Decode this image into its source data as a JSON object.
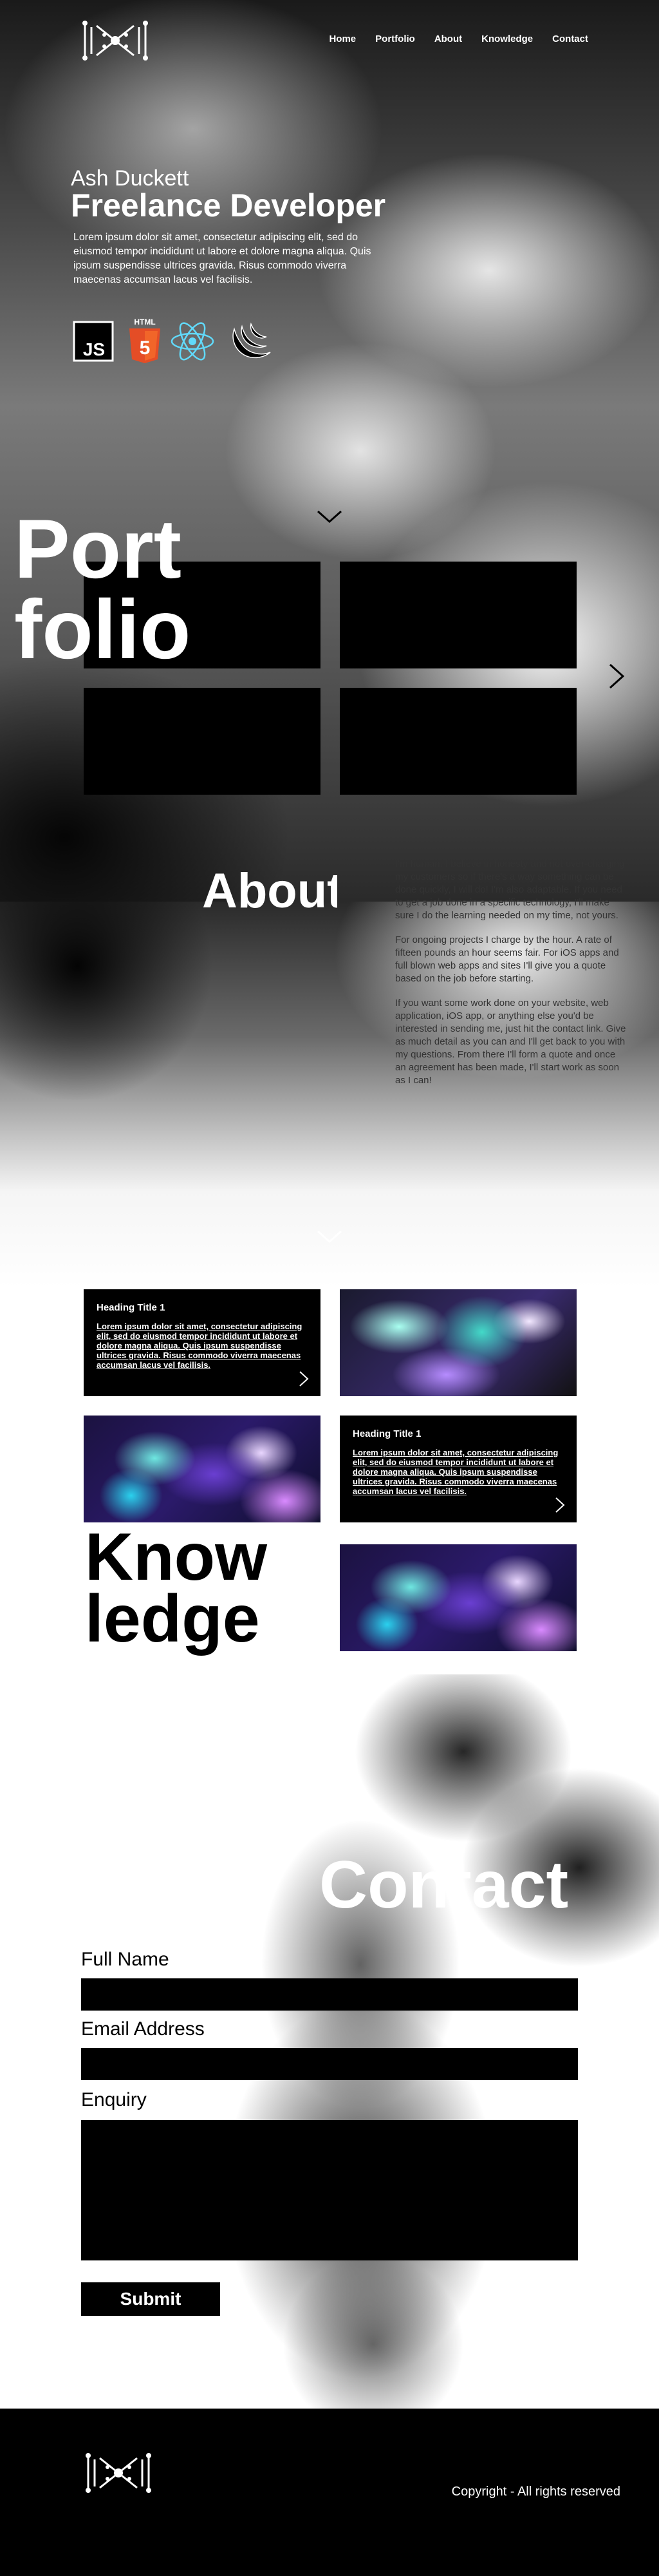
{
  "nav": {
    "logo": "logo-icon",
    "items": [
      "Home",
      "Portfolio",
      "About",
      "Knowledge",
      "Contact"
    ]
  },
  "hero": {
    "name": "Ash Duckett",
    "title": "Freelance Developer",
    "text": "Lorem ipsum dolor sit amet, consectetur adipiscing elit, sed do eiusmod tempor incididunt ut labore et dolore magna aliqua. Quis ipsum suspendisse ultrices gravida. Risus commodo viverra maecenas accumsan lacus vel facilisis.",
    "tech_icons": [
      {
        "name": "js-icon",
        "label": "JS"
      },
      {
        "name": "html5-icon",
        "label": "HTML",
        "number": "5"
      },
      {
        "name": "react-icon"
      },
      {
        "name": "jquery-icon"
      }
    ]
  },
  "portfolio": {
    "heading_line1": "Port",
    "heading_line2": "folio"
  },
  "about": {
    "heading": "About",
    "paragraphs": [
      "I'm human. I believe in honesty and not over-charging my customers so if there's a way something can be done quickly, I will do! I'm also adaptable. If you need to get a job done in a specific technology, I'll make sure I do the learning needed on my time, not yours.",
      "For ongoing projects I charge by the hour. A rate of fifteen pounds an hour seems fair. For iOS apps and full blown web apps and sites I'll give you a quote based on the job before starting.",
      "If you want some work done on your website, web application, iOS app, or anything else you'd be interested in sending me, just hit the contact link. Give as much detail as you can and I'll get back to you with my questions. From there I'll form a quote and once an agreement has been made, I'll start work as soon as I can!"
    ]
  },
  "knowledge": {
    "heading_line1": "Know",
    "heading_line2": "ledge",
    "cards": [
      {
        "title": "Heading Title 1",
        "text": "Lorem ipsum dolor sit amet, consectetur adipiscing elit, sed do eiusmod tempor incididunt ut labore et dolore magna aliqua. Quis ipsum suspendisse ultrices gravida. Risus commodo viverra maecenas accumsan lacus vel facilisis."
      },
      {
        "title": "Heading Title 1",
        "text": "Lorem ipsum dolor sit amet, consectetur adipiscing elit, sed do eiusmod tempor incididunt ut labore et dolore magna aliqua. Quis ipsum suspendisse ultrices gravida. Risus commodo viverra maecenas accumsan lacus vel facilisis."
      }
    ]
  },
  "contact": {
    "heading": "Contact",
    "full_name_label": "Full Name",
    "email_label": "Email Address",
    "enquiry_label": "Enquiry",
    "submit_label": "Submit"
  },
  "footer": {
    "copyright": "Copyright - All rights reserved"
  },
  "colors": {
    "black": "#000000",
    "white": "#ffffff",
    "html5_orange": "#e44d26",
    "react_cyan": "#61dafb"
  }
}
